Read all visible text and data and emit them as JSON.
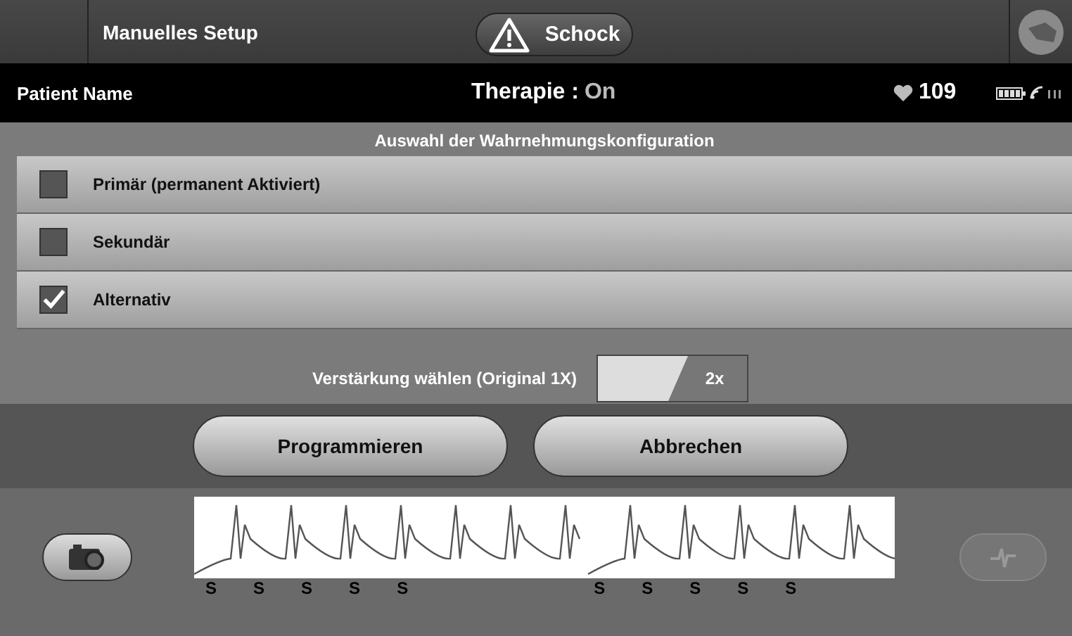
{
  "header": {
    "title": "Manuelles Setup",
    "shock_button": "Schock"
  },
  "status_bar": {
    "patient": "Patient Name",
    "therapy_label": "Therapie :",
    "therapy_value": "On",
    "heart_rate": "109"
  },
  "section_title": "Auswahl der Wahrnehmungskonfiguration",
  "options": [
    {
      "label": "Primär (permanent Aktiviert)",
      "checked": false
    },
    {
      "label": "Sekundär",
      "checked": false
    },
    {
      "label": "Alternativ",
      "checked": true
    }
  ],
  "gain": {
    "label": "Verstärkung wählen (Original 1X)",
    "value": "2x"
  },
  "buttons": [
    "Programmieren",
    "Abbrechen"
  ],
  "ecg": {
    "marker_groups": [
      [
        "S",
        "S",
        "S",
        "S",
        "S"
      ],
      [
        "S",
        "S",
        "S",
        "S",
        "S"
      ]
    ],
    "analyze_disabled": true
  }
}
